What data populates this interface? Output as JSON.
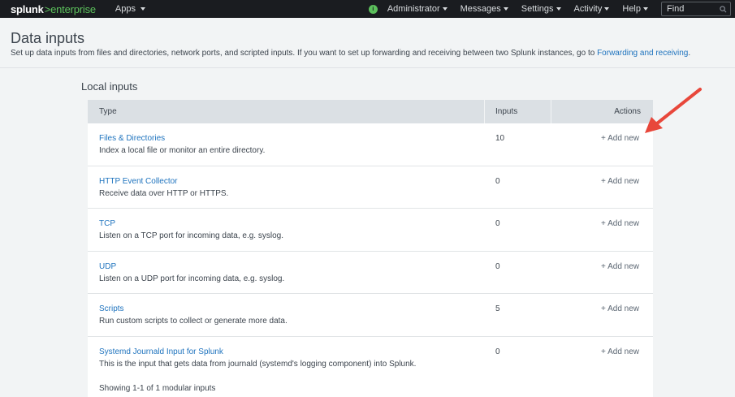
{
  "topbar": {
    "logo_brand": "splunk",
    "logo_sep": ">",
    "logo_product": "enterprise",
    "apps": "Apps",
    "avatar_letter": "i",
    "nav": [
      "Administrator",
      "Messages",
      "Settings",
      "Activity",
      "Help"
    ],
    "find_placeholder": "Find"
  },
  "header": {
    "title": "Data inputs",
    "description": "Set up data inputs from files and directories, network ports, and scripted inputs. If you want to set up forwarding and receiving between two Splunk instances, go to ",
    "link": "Forwarding and receiving",
    "period": "."
  },
  "local_inputs": {
    "title": "Local inputs",
    "columns": {
      "type": "Type",
      "inputs": "Inputs",
      "actions": "Actions"
    },
    "rows": [
      {
        "name": "Files & Directories",
        "desc": "Index a local file or monitor an entire directory.",
        "count": "10",
        "action": "+ Add new"
      },
      {
        "name": "HTTP Event Collector",
        "desc": "Receive data over HTTP or HTTPS.",
        "count": "0",
        "action": "+ Add new"
      },
      {
        "name": "TCP",
        "desc": "Listen on a TCP port for incoming data, e.g. syslog.",
        "count": "0",
        "action": "+ Add new"
      },
      {
        "name": "UDP",
        "desc": "Listen on a UDP port for incoming data, e.g. syslog.",
        "count": "0",
        "action": "+ Add new"
      },
      {
        "name": "Scripts",
        "desc": "Run custom scripts to collect or generate more data.",
        "count": "5",
        "action": "+ Add new"
      },
      {
        "name": "Systemd Journald Input for Splunk",
        "desc": "This is the input that gets data from journald (systemd's logging component) into Splunk.",
        "count": "0",
        "action": "+ Add new"
      }
    ],
    "footer": "Showing 1-1 of 1 modular inputs"
  },
  "colors": {
    "topbar": "#1a1c20",
    "brand_green": "#5cc05c",
    "link": "#1e73be",
    "annotation_arrow": "#e8473b"
  }
}
